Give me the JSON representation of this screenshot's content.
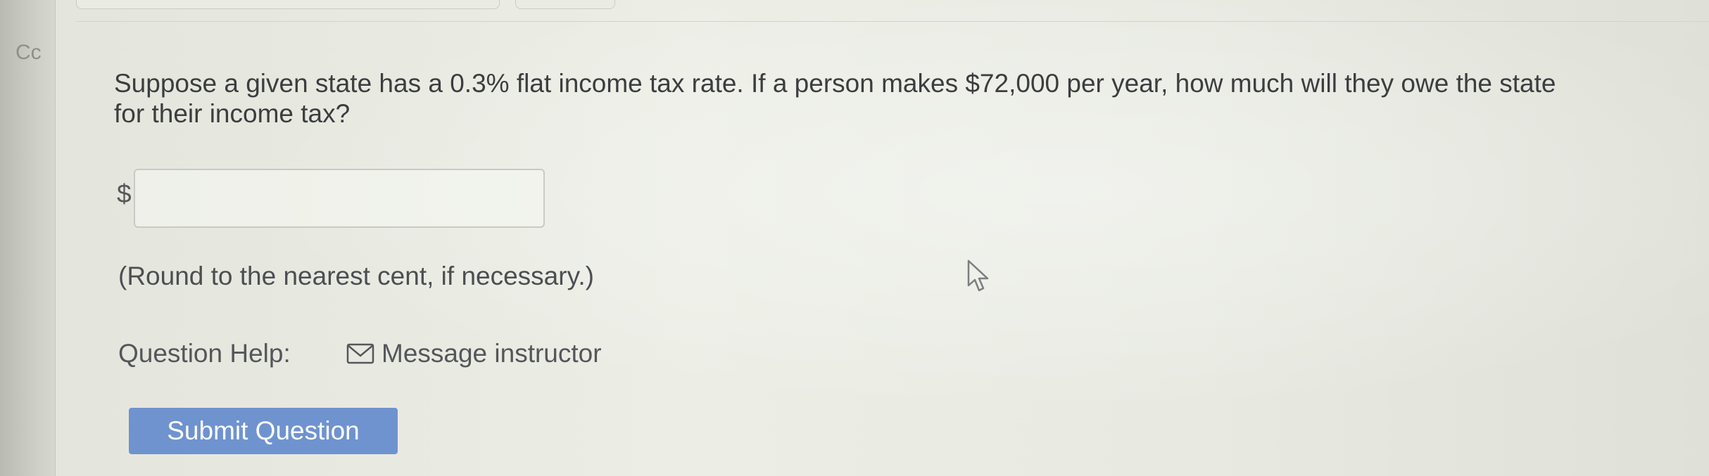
{
  "left_strip": {
    "letter": "Cc"
  },
  "question": {
    "text": "Suppose a given state has a 0.3% flat income tax rate. If a person makes $72,000 per year, how much will they owe the state for their income tax?"
  },
  "answer": {
    "prefix": "$",
    "value": "",
    "placeholder": ""
  },
  "hint": "(Round to the nearest cent, if necessary.)",
  "help": {
    "label": "Question Help:",
    "message_icon": "envelope-icon",
    "message_label": "Message instructor"
  },
  "submit": {
    "label": "Submit Question"
  },
  "colors": {
    "button": "#6f93cf",
    "text": "#3c3d3f"
  },
  "cursor": "mouse-pointer-icon"
}
